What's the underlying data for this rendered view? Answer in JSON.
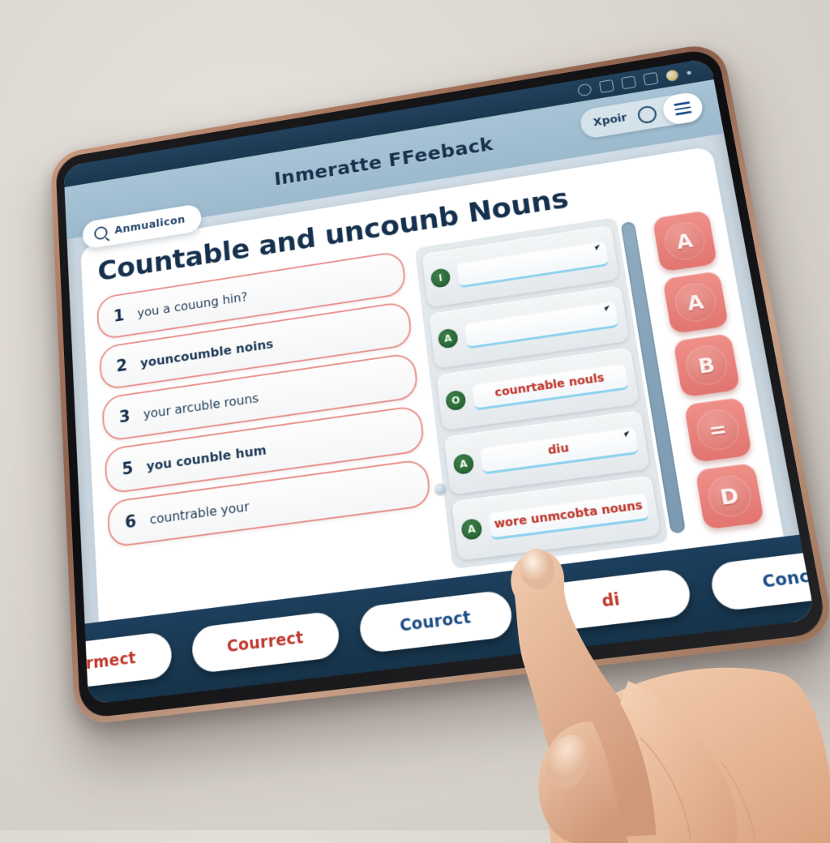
{
  "statusbar": {
    "icons": [
      "power-icon",
      "book-icon",
      "battery-icon",
      "cast-icon",
      "orb-icon",
      "dot-icon"
    ]
  },
  "header": {
    "title": "Inmeratte FFeeback",
    "account_label": "Xpoir",
    "search_icon": "search-circle-icon",
    "menu_icon": "hamburger-menu-icon"
  },
  "search": {
    "icon": "magnifier-icon",
    "value": "Anmualicon"
  },
  "page": {
    "title": "Countable and uncounb Nouns"
  },
  "questions": [
    {
      "num": "1",
      "text": "you a couung hin?",
      "bold": false
    },
    {
      "num": "2",
      "text": "youncoumble noins",
      "bold": true
    },
    {
      "num": "3",
      "text": "your arcuble rouns",
      "bold": false
    },
    {
      "num": "5",
      "text": "you counble hum",
      "bold": true
    },
    {
      "num": "6",
      "text": "countrable your",
      "bold": false
    }
  ],
  "answer_cards": [
    {
      "badge": "I",
      "answer": "",
      "caret": true
    },
    {
      "badge": "A",
      "answer": "",
      "caret": true
    },
    {
      "badge": "O",
      "answer": "counrtable nouls",
      "caret": false
    },
    {
      "badge": "A",
      "answer": "diu",
      "caret": true
    },
    {
      "badge": "A",
      "answer": "wore unmcobta nouns",
      "caret": false
    }
  ],
  "letter_buttons": [
    {
      "label": "A"
    },
    {
      "label": "A"
    },
    {
      "label": "B"
    },
    {
      "label": "="
    },
    {
      "label": "D"
    }
  ],
  "footer_buttons": [
    {
      "label": "Cormect",
      "tone": "red"
    },
    {
      "label": "Courrect",
      "tone": "red"
    },
    {
      "label": "Couroct",
      "tone": "blue"
    },
    {
      "label": "di",
      "tone": "red"
    },
    {
      "label": "Conch",
      "tone": "blue"
    }
  ],
  "colors": {
    "accent_red": "#c0392f",
    "accent_blue": "#1b4e86",
    "header_blue": "#9cbacd",
    "footer_navy": "#1d3f5d",
    "button_salmon": "#e2756f",
    "badge_green": "#20602f",
    "card_cyan": "#8fd2ef",
    "question_border": "#e8918d"
  },
  "scrollbar": {
    "name": "vertical-scroll-track"
  },
  "hand": {
    "name": "hand-touching-screen",
    "gesture": "index-finger-tap"
  }
}
